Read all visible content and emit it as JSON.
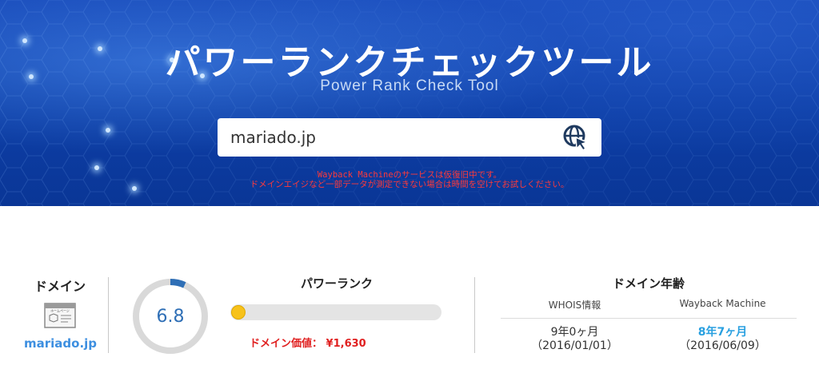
{
  "hero": {
    "title": "パワーランクチェックツール",
    "subtitle": "Power Rank Check Tool",
    "bg_color": "#0d3ea6"
  },
  "search": {
    "value": "mariado.jp",
    "placeholder": "",
    "button_icon": "globe-cursor-icon"
  },
  "notice": {
    "line1": "Wayback Machineのサービスは仮復旧中です。",
    "line2": "ドメインエイジなど一部データが測定できない場合は時間を空けてお試しください。",
    "color": "#ff3a3a"
  },
  "domain": {
    "label": "ドメイン",
    "value": "mariado.jp",
    "icon": "homepage-window-icon",
    "icon_text": "ホームページ",
    "link_color": "#3d8fe0"
  },
  "score": {
    "value": "6.8",
    "gauge_fraction": 0.068,
    "accent": "#2f6fb6"
  },
  "power_rank": {
    "title": "パワーランク",
    "bar_fraction": 0.0,
    "knob_color": "#f7c21b"
  },
  "price": {
    "label": "ドメイン価値：",
    "value": "¥1,630",
    "color": "#e02020"
  },
  "domain_age": {
    "title": "ドメイン年齢",
    "columns": [
      "WHOIS情報",
      "Wayback Machine"
    ],
    "whois": {
      "age": "9年0ヶ月",
      "date": "（2016/01/01）"
    },
    "wayback": {
      "age": "8年7ヶ月",
      "date": "（2016/06/09）",
      "color": "#29a0e0"
    }
  }
}
